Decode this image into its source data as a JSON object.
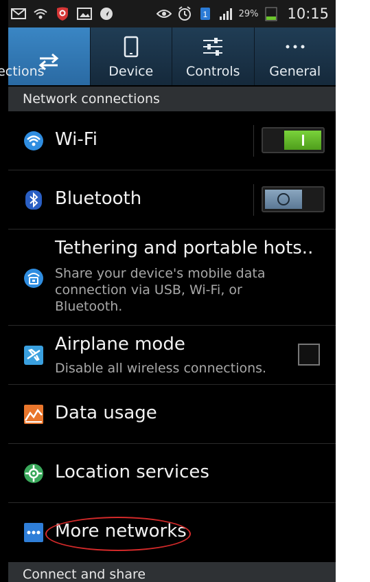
{
  "status_bar": {
    "battery_percent": "29%",
    "time": "10:15",
    "sim_badge": "1"
  },
  "tabs": [
    {
      "label": "nnections",
      "icon": "swap-arrows-icon",
      "active": true
    },
    {
      "label": "Device",
      "icon": "phone-icon",
      "active": false
    },
    {
      "label": "Controls",
      "icon": "sliders-icon",
      "active": false
    },
    {
      "label": "General",
      "icon": "more-dots-icon",
      "active": false
    }
  ],
  "sections": {
    "network": "Network connections",
    "connect_share": "Connect and share"
  },
  "rows": {
    "wifi": {
      "title": "Wi-Fi",
      "toggle": "on"
    },
    "bluetooth": {
      "title": "Bluetooth",
      "toggle": "off"
    },
    "tethering": {
      "title": "Tethering and portable hots..",
      "subtitle": "Share your device's mobile data connection via USB, Wi-Fi, or Bluetooth."
    },
    "airplane": {
      "title": "Airplane mode",
      "subtitle": "Disable all wireless connections.",
      "checked": false
    },
    "data_usage": {
      "title": "Data usage"
    },
    "location": {
      "title": "Location services"
    },
    "more_networks": {
      "title": "More networks"
    }
  },
  "colors": {
    "tab_active": "#2a6aa3",
    "toggle_on": "#5fb52a",
    "annotation_circle": "#d42a2a"
  }
}
